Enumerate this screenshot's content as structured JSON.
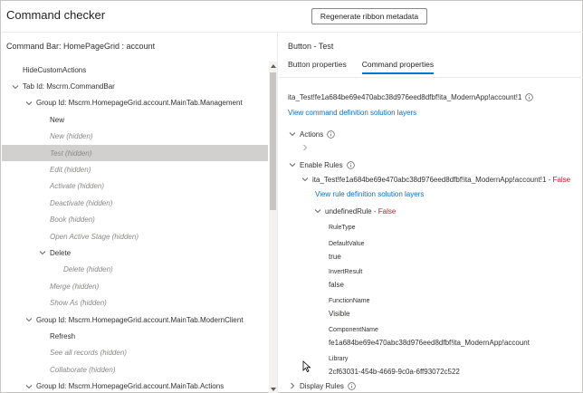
{
  "app": {
    "title": "Command checker",
    "regenerate_label": "Regenerate ribbon metadata"
  },
  "left": {
    "title": "Command Bar: HomePageGrid : account",
    "tree": [
      {
        "label": "HideCustomActions",
        "indent": 0,
        "chevron": "none",
        "hidden": false
      },
      {
        "label": "Tab Id: Mscrm.CommandBar",
        "indent": 0,
        "chevron": "down",
        "hidden": false
      },
      {
        "label": "Group Id: Mscrm.HomepageGrid.account.MainTab.Management",
        "indent": 1,
        "chevron": "down",
        "hidden": false
      },
      {
        "label": "New",
        "indent": 2,
        "chevron": "none",
        "hidden": false
      },
      {
        "label": "New (hidden)",
        "indent": 2,
        "chevron": "none",
        "hidden": true
      },
      {
        "label": "Test (hidden)",
        "indent": 2,
        "chevron": "none",
        "hidden": true,
        "selected": true
      },
      {
        "label": "Edit (hidden)",
        "indent": 2,
        "chevron": "none",
        "hidden": true
      },
      {
        "label": "Activate (hidden)",
        "indent": 2,
        "chevron": "none",
        "hidden": true
      },
      {
        "label": "Deactivate (hidden)",
        "indent": 2,
        "chevron": "none",
        "hidden": true
      },
      {
        "label": "Book (hidden)",
        "indent": 2,
        "chevron": "none",
        "hidden": true
      },
      {
        "label": "Open Active Stage (hidden)",
        "indent": 2,
        "chevron": "none",
        "hidden": true
      },
      {
        "label": "Delete",
        "indent": 2,
        "chevron": "down",
        "hidden": false
      },
      {
        "label": "Delete (hidden)",
        "indent": 3,
        "chevron": "none",
        "hidden": true
      },
      {
        "label": "Merge (hidden)",
        "indent": 2,
        "chevron": "none",
        "hidden": true
      },
      {
        "label": "Show As (hidden)",
        "indent": 2,
        "chevron": "none",
        "hidden": true
      },
      {
        "label": "Group Id: Mscrm.HomepageGrid.account.MainTab.ModernClient",
        "indent": 1,
        "chevron": "down",
        "hidden": false
      },
      {
        "label": "Refresh",
        "indent": 2,
        "chevron": "none",
        "hidden": false
      },
      {
        "label": "See all records (hidden)",
        "indent": 2,
        "chevron": "none",
        "hidden": true
      },
      {
        "label": "Collaborate (hidden)",
        "indent": 2,
        "chevron": "none",
        "hidden": true
      },
      {
        "label": "Group Id: Mscrm.HomepageGrid.account.MainTab.Actions",
        "indent": 1,
        "chevron": "down",
        "hidden": false
      }
    ]
  },
  "right": {
    "title": "Button - Test",
    "tabs": [
      {
        "label": "Button properties",
        "active": false
      },
      {
        "label": "Command properties",
        "active": true
      }
    ],
    "command_id": "ita_Test!fe1a684be69e470abc38d976eed8dfbf!ita_ModernApp!account!1",
    "view_command_link": "View command definition solution layers",
    "actions_label": "Actions",
    "enable_rules_label": "Enable Rules",
    "rule_id": "ita_Test!fe1a684be69e470abc38d976eed8dfbf!ita_ModernApp!account!1",
    "rule_result": "- False",
    "view_rule_link": "View rule definition solution layers",
    "undefined_rule_name": "undefinedRule",
    "undefined_rule_result": "- False",
    "properties": [
      {
        "name": "RuleType",
        "value": ""
      },
      {
        "name": "DefaultValue",
        "value": "true"
      },
      {
        "name": "InvertResult",
        "value": "false"
      },
      {
        "name": "FunctionName",
        "value": "Visible"
      },
      {
        "name": "ComponentName",
        "value": "fe1a684be69e470abc38d976eed8dfbf!ita_ModernApp!account"
      },
      {
        "name": "Library",
        "value": "2cf63031-454b-4669-9c0a-6ff93072c522"
      }
    ],
    "display_rules_label": "Display Rules"
  },
  "colors": {
    "accent": "#0078d4",
    "link": "#0f6cbd",
    "false": "#a4262c",
    "selected_row": "#d2d0ce"
  },
  "icons": {
    "expanded": "chevron-down-icon",
    "collapsed": "chevron-right-icon",
    "info": "info-icon"
  }
}
